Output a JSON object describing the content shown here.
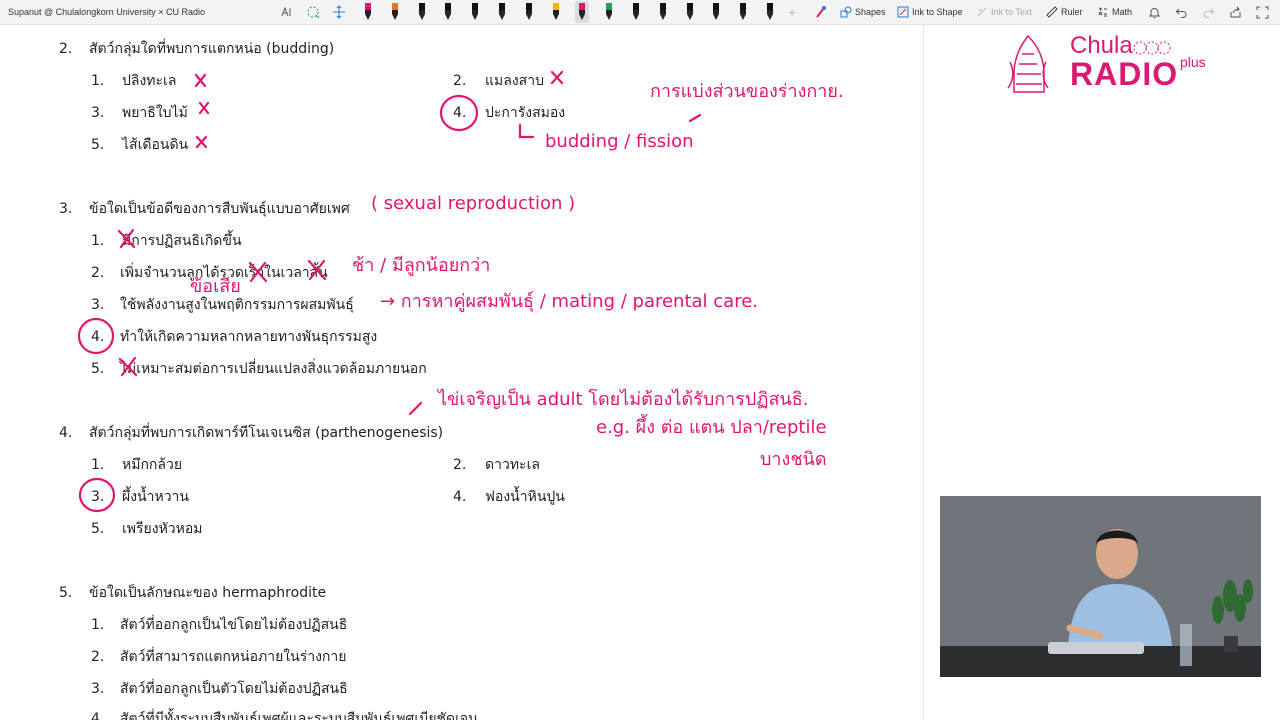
{
  "window": {
    "title": "Supanut @ Chulalongkorn University × CU Radio"
  },
  "toolbar": {
    "shapes_label": "Shapes",
    "ink_to_shape_label": "Ink to Shape",
    "ink_to_text_label": "Ink to Text",
    "ruler_label": "Ruler",
    "math_label": "Math",
    "pen_colors": [
      "#e0166e",
      "#e8702a",
      "#111111",
      "#111111",
      "#111111",
      "#111111",
      "#111111",
      "#f5b400",
      "#e0166e",
      "#22a05b",
      "#111111",
      "#111111",
      "#111111",
      "#111111",
      "#111111",
      "#111111"
    ]
  },
  "questions": [
    {
      "number": "2.",
      "text": "สัตว์กลุ่มใดที่พบการแตกหน่อ (budding)",
      "options": [
        {
          "num": "1.",
          "text": "ปลิงทะเล"
        },
        {
          "num": "2.",
          "text": "แมลงสาบ"
        },
        {
          "num": "3.",
          "text": "พยาธิใบไม้"
        },
        {
          "num": "4.",
          "text": "ปะการังสมอง"
        },
        {
          "num": "5.",
          "text": "ไส้เดือนดิน"
        }
      ]
    },
    {
      "number": "3.",
      "text": "ข้อใดเป็นข้อดีของการสืบพันธุ์แบบอาศัยเพศ",
      "options": [
        {
          "num": "1.",
          "text": "มีการปฏิสนธิเกิดขึ้น"
        },
        {
          "num": "2.",
          "text": "เพิ่มจำนวนลูกได้รวดเร็วในเวลาสั้น"
        },
        {
          "num": "3.",
          "text": "ใช้พลังงานสูงในพฤติกรรมการผสมพันธุ์"
        },
        {
          "num": "4.",
          "text": "ทำให้เกิดความหลากหลายทางพันธุกรรมสูง"
        },
        {
          "num": "5.",
          "text": "ไม่เหมาะสมต่อการเปลี่ยนแปลงสิ่งแวดล้อมภายนอก"
        }
      ]
    },
    {
      "number": "4.",
      "text": "สัตว์กลุ่มที่พบการเกิดพาร์ทีโนเจเนซิส (parthenogenesis)",
      "options": [
        {
          "num": "1.",
          "text": "หมึกกล้วย"
        },
        {
          "num": "2.",
          "text": "ดาวทะเล"
        },
        {
          "num": "3.",
          "text": "ผึ้งน้ำหวาน"
        },
        {
          "num": "4.",
          "text": "ฟองน้ำหินปูน"
        },
        {
          "num": "5.",
          "text": "เพรียงหัวหอม"
        }
      ]
    },
    {
      "number": "5.",
      "text": "ข้อใดเป็นลักษณะของ hermaphrodite",
      "options": [
        {
          "num": "1.",
          "text": "สัตว์ที่ออกลูกเป็นไข่โดยไม่ต้องปฏิสนธิ"
        },
        {
          "num": "2.",
          "text": "สัตว์ที่สามารถแตกหน่อภายในร่างกาย"
        },
        {
          "num": "3.",
          "text": "สัตว์ที่ออกลูกเป็นตัวโดยไม่ต้องปฏิสนธิ"
        },
        {
          "num": "4.",
          "text": "สัตว์ที่มีทั้งระบบสืบพันธุ์เพศผู้และระบบสืบพันธุ์เพศเมียชัดเจน"
        }
      ]
    }
  ],
  "annotations": {
    "q2_note_thai": "การแบ่งส่วนของร่างกาย.",
    "q2_note_en": "budding / fission",
    "q3_title_note": "( sexual reproduction )",
    "q3_opt1_note": "ข้อเสีย",
    "q3_opt2_note": "ช้า / มีลูกน้อยกว่า",
    "q3_opt3_note": "→ การหาคู่ผสมพันธุ์ / mating / parental care.",
    "q4_note_line1": "ไข่เจริญเป็น adult โดยไม่ต้องได้รับการปฏิสนธิ.",
    "q4_note_line2": "e.g. ผึ้ง ต่อ แตน ปลา/reptile",
    "q4_note_line3": "บางชนิด"
  },
  "logo": {
    "text_top": "Chula",
    "text_bottom": "RADIO",
    "text_plus": "plus",
    "brand_color": "#d81b72"
  },
  "video": {
    "description_icon": "presenter-video-feed"
  }
}
